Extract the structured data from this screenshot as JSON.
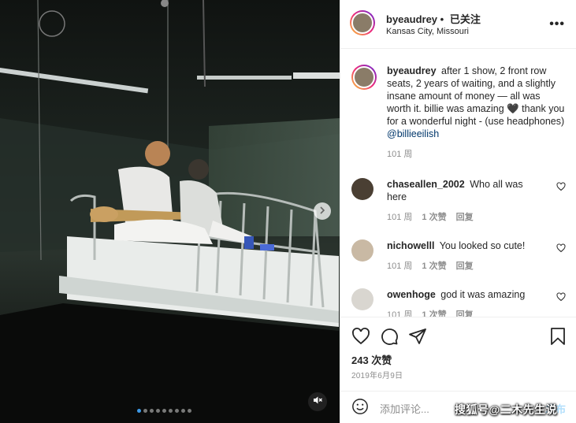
{
  "post": {
    "username": "byeaudrey",
    "follow_status": "已关注",
    "separator": "•",
    "location": "Kansas City, Missouri",
    "more_label": "•••"
  },
  "caption": {
    "username": "byeaudrey",
    "text": "after 1 show, 2 front row seats, 2 years of waiting, and a slightly insane amount of money — all was worth it. billie was amazing 🖤 thank you for a wonderful night - (use headphones)",
    "mention": "@billieeilish",
    "age": "101 周"
  },
  "comments": [
    {
      "username": "chaseallen_2002",
      "text": "Who all was here",
      "age": "101 周",
      "likes": "1 次赞",
      "reply": "回复"
    },
    {
      "username": "nichowelll",
      "text": "You looked so cute!",
      "age": "101 周",
      "likes": "1 次赞",
      "reply": "回复"
    },
    {
      "username": "owenhoge",
      "text": "god it was amazing",
      "age": "101 周",
      "likes": "1 次赞",
      "reply": "回复"
    }
  ],
  "engagement": {
    "likes_count": "243 次赞",
    "date": "2019年6月9日"
  },
  "composer": {
    "placeholder": "添加评论...",
    "post_label": "发布"
  },
  "watermark": "搜狐号@二木先生说",
  "carousel": {
    "count": 9,
    "active_index": 0
  },
  "colors": {
    "link": "#00376b",
    "muted": "#8e8e8e",
    "active_dot": "#3d9ae8"
  }
}
